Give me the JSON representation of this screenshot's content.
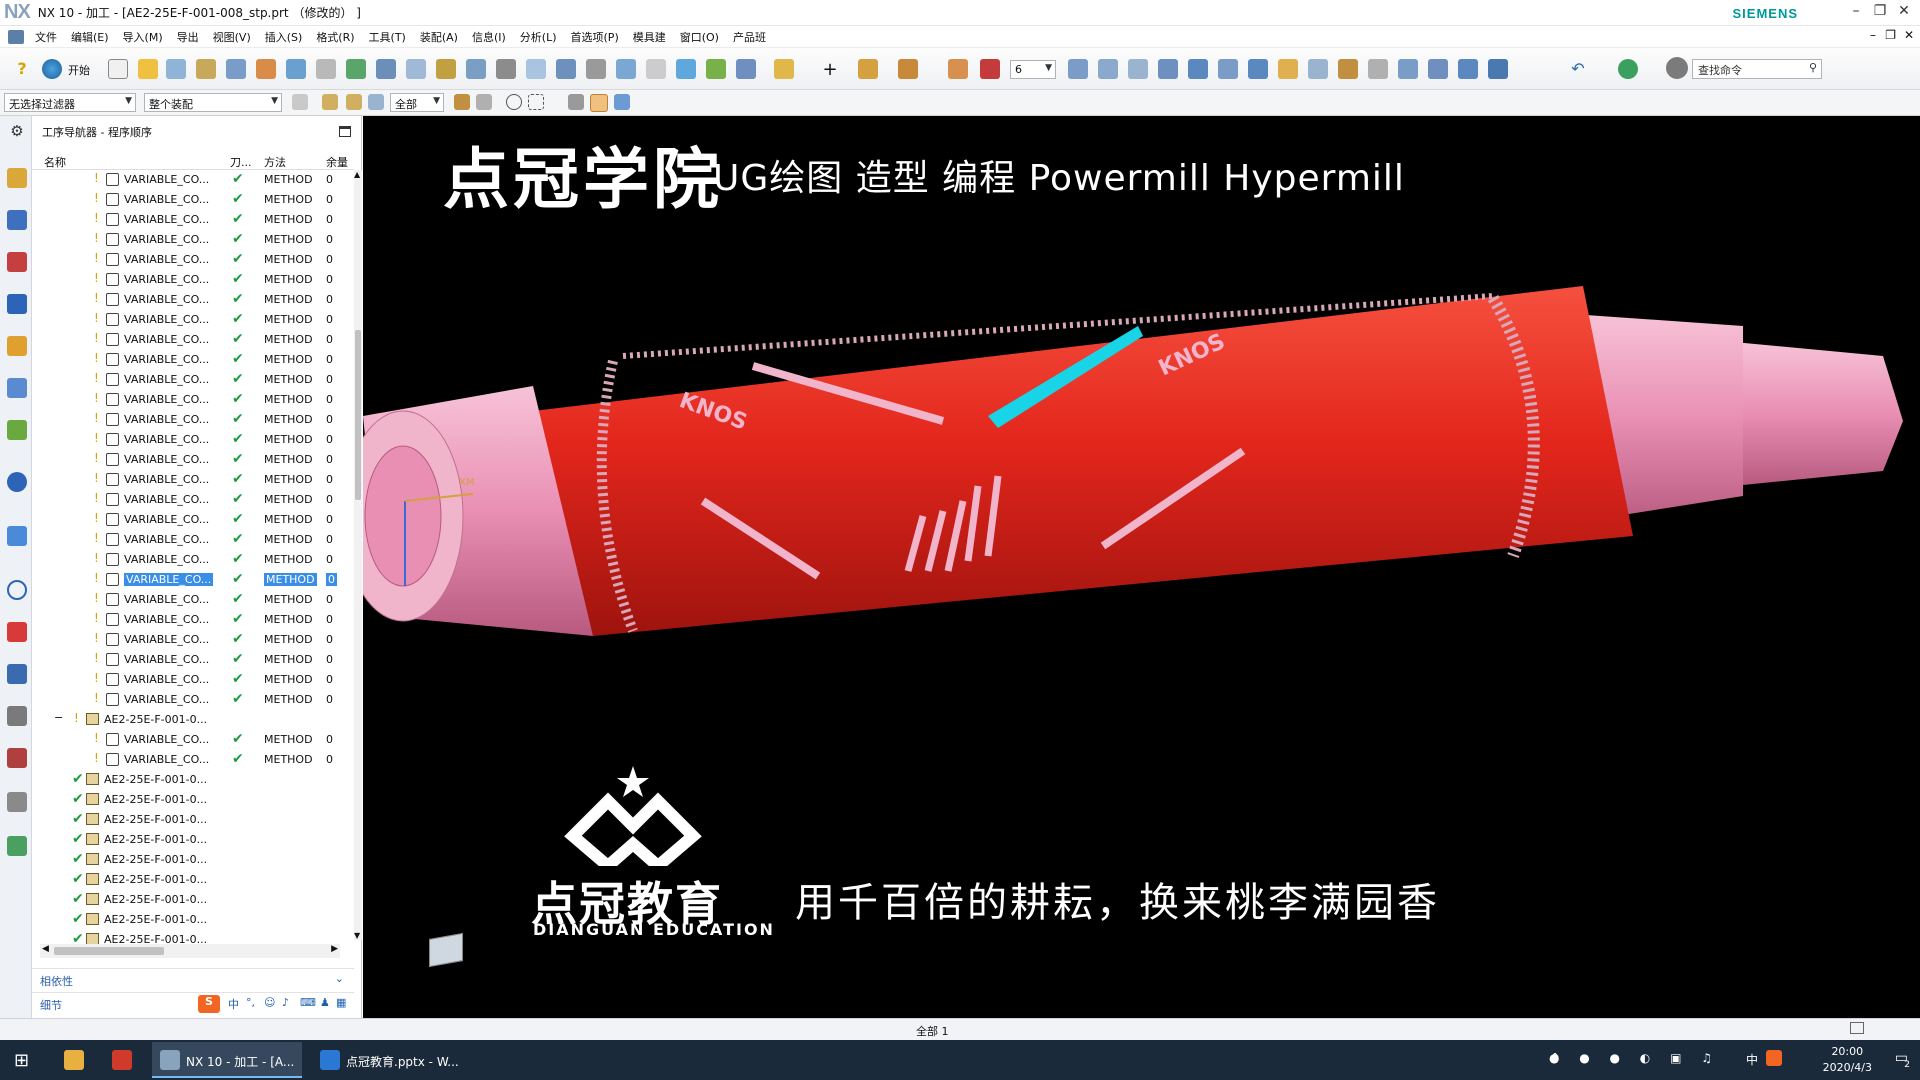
{
  "app": {
    "logo": "NX",
    "title": "NX 10 - 加工 - [AE2-25E-F-001-008_stp.prt （修改的） ]",
    "brand": "SIEMENS"
  },
  "menu": [
    "文件",
    "编辑(E)",
    "导入(M)",
    "导出",
    "视图(V)",
    "插入(S)",
    "格式(R)",
    "工具(T)",
    "装配(A)",
    "信息(I)",
    "分析(L)",
    "首选项(P)",
    "模具建",
    "窗口(O)",
    "产品班"
  ],
  "toolbar": {
    "start_label": "开始",
    "layer_value": "6",
    "search_placeholder": "查找命令"
  },
  "filterbar": {
    "filter": "无选择过滤器",
    "assembly": "整个装配",
    "scope": "全部"
  },
  "navigator": {
    "title": "工序导航器 - 程序顺序",
    "columns": [
      "名称",
      "刀...",
      "方法",
      "余量"
    ],
    "rows": [
      {
        "name": "VARIABLE_CO...",
        "method": "METHOD",
        "stock": "0",
        "kind": "op",
        "checked": true
      },
      {
        "name": "VARIABLE_CO...",
        "method": "METHOD",
        "stock": "0",
        "kind": "op",
        "checked": true
      },
      {
        "name": "VARIABLE_CO...",
        "method": "METHOD",
        "stock": "0",
        "kind": "op",
        "checked": true
      },
      {
        "name": "VARIABLE_CO...",
        "method": "METHOD",
        "stock": "0",
        "kind": "op",
        "checked": true
      },
      {
        "name": "VARIABLE_CO...",
        "method": "METHOD",
        "stock": "0",
        "kind": "op",
        "checked": true
      },
      {
        "name": "VARIABLE_CO...",
        "method": "METHOD",
        "stock": "0",
        "kind": "op",
        "checked": true
      },
      {
        "name": "VARIABLE_CO...",
        "method": "METHOD",
        "stock": "0",
        "kind": "op",
        "checked": true
      },
      {
        "name": "VARIABLE_CO...",
        "method": "METHOD",
        "stock": "0",
        "kind": "op",
        "checked": true
      },
      {
        "name": "VARIABLE_CO...",
        "method": "METHOD",
        "stock": "0",
        "kind": "op",
        "checked": true
      },
      {
        "name": "VARIABLE_CO...",
        "method": "METHOD",
        "stock": "0",
        "kind": "op",
        "checked": true
      },
      {
        "name": "VARIABLE_CO...",
        "method": "METHOD",
        "stock": "0",
        "kind": "op",
        "checked": true
      },
      {
        "name": "VARIABLE_CO...",
        "method": "METHOD",
        "stock": "0",
        "kind": "op",
        "checked": true
      },
      {
        "name": "VARIABLE_CO...",
        "method": "METHOD",
        "stock": "0",
        "kind": "op",
        "checked": true
      },
      {
        "name": "VARIABLE_CO...",
        "method": "METHOD",
        "stock": "0",
        "kind": "op",
        "checked": true
      },
      {
        "name": "VARIABLE_CO...",
        "method": "METHOD",
        "stock": "0",
        "kind": "op",
        "checked": true
      },
      {
        "name": "VARIABLE_CO...",
        "method": "METHOD",
        "stock": "0",
        "kind": "op",
        "checked": true
      },
      {
        "name": "VARIABLE_CO...",
        "method": "METHOD",
        "stock": "0",
        "kind": "op",
        "checked": true
      },
      {
        "name": "VARIABLE_CO...",
        "method": "METHOD",
        "stock": "0",
        "kind": "op",
        "checked": true
      },
      {
        "name": "VARIABLE_CO...",
        "method": "METHOD",
        "stock": "0",
        "kind": "op",
        "checked": true
      },
      {
        "name": "VARIABLE_CO...",
        "method": "METHOD",
        "stock": "0",
        "kind": "op",
        "checked": true
      },
      {
        "name": "VARIABLE_CO...",
        "method": "METHOD",
        "stock": "0",
        "kind": "op",
        "checked": true,
        "selected": true
      },
      {
        "name": "VARIABLE_CO...",
        "method": "METHOD",
        "stock": "0",
        "kind": "op",
        "checked": true
      },
      {
        "name": "VARIABLE_CO...",
        "method": "METHOD",
        "stock": "0",
        "kind": "op",
        "checked": true
      },
      {
        "name": "VARIABLE_CO...",
        "method": "METHOD",
        "stock": "0",
        "kind": "op",
        "checked": true
      },
      {
        "name": "VARIABLE_CO...",
        "method": "METHOD",
        "stock": "0",
        "kind": "op",
        "checked": true
      },
      {
        "name": "VARIABLE_CO...",
        "method": "METHOD",
        "stock": "0",
        "kind": "op",
        "checked": true
      },
      {
        "name": "VARIABLE_CO...",
        "method": "METHOD",
        "stock": "0",
        "kind": "op",
        "checked": true
      },
      {
        "name": "AE2-25E-F-001-0...",
        "method": "",
        "stock": "",
        "kind": "group",
        "checked": false
      },
      {
        "name": "VARIABLE_CO...",
        "method": "METHOD",
        "stock": "0",
        "kind": "op",
        "checked": true
      },
      {
        "name": "VARIABLE_CO...",
        "method": "METHOD",
        "stock": "0",
        "kind": "op",
        "checked": true
      },
      {
        "name": "AE2-25E-F-001-0...",
        "method": "",
        "stock": "",
        "kind": "topgroup",
        "checked": true
      },
      {
        "name": "AE2-25E-F-001-0...",
        "method": "",
        "stock": "",
        "kind": "topgroup",
        "checked": true
      },
      {
        "name": "AE2-25E-F-001-0...",
        "method": "",
        "stock": "",
        "kind": "topgroup",
        "checked": true
      },
      {
        "name": "AE2-25E-F-001-0...",
        "method": "",
        "stock": "",
        "kind": "topgroup",
        "checked": true
      },
      {
        "name": "AE2-25E-F-001-0...",
        "method": "",
        "stock": "",
        "kind": "topgroup",
        "checked": true
      },
      {
        "name": "AE2-25E-F-001-0...",
        "method": "",
        "stock": "",
        "kind": "topgroup",
        "checked": true
      },
      {
        "name": "AE2-25E-F-001-0...",
        "method": "",
        "stock": "",
        "kind": "topgroup",
        "checked": true
      },
      {
        "name": "AE2-25E-F-001-0...",
        "method": "",
        "stock": "",
        "kind": "topgroup",
        "checked": true
      },
      {
        "name": "AE2-25E-F-001-0...",
        "method": "",
        "stock": "",
        "kind": "topgroup",
        "checked": true
      }
    ],
    "footer_dependencies": "相依性",
    "footer_details": "细节"
  },
  "viewport": {
    "banner_title": "点冠学院",
    "banner_subtitle": "UG绘图 造型 编程 Powermill Hypermill",
    "logo_cn": "点冠教育",
    "logo_en": "DIANGUAN EDUCATION",
    "slogan": "用千百倍的耕耘，换来桃李满园香",
    "engraving": "KNOS",
    "axis_label": "XM"
  },
  "status": {
    "center": "全部 1"
  },
  "taskbar": {
    "items": [
      "NX 10 - 加工 - [A...",
      "点冠教育.pptx - W..."
    ],
    "ime": "中",
    "time": "20:00",
    "date": "2020/4/3",
    "notif_count": "2"
  },
  "colors": {
    "part_red": "#e3261c",
    "part_pink": "#e98fb3",
    "selection_cyan": "#19d3e6",
    "accent_blue": "#3a8ee6"
  }
}
